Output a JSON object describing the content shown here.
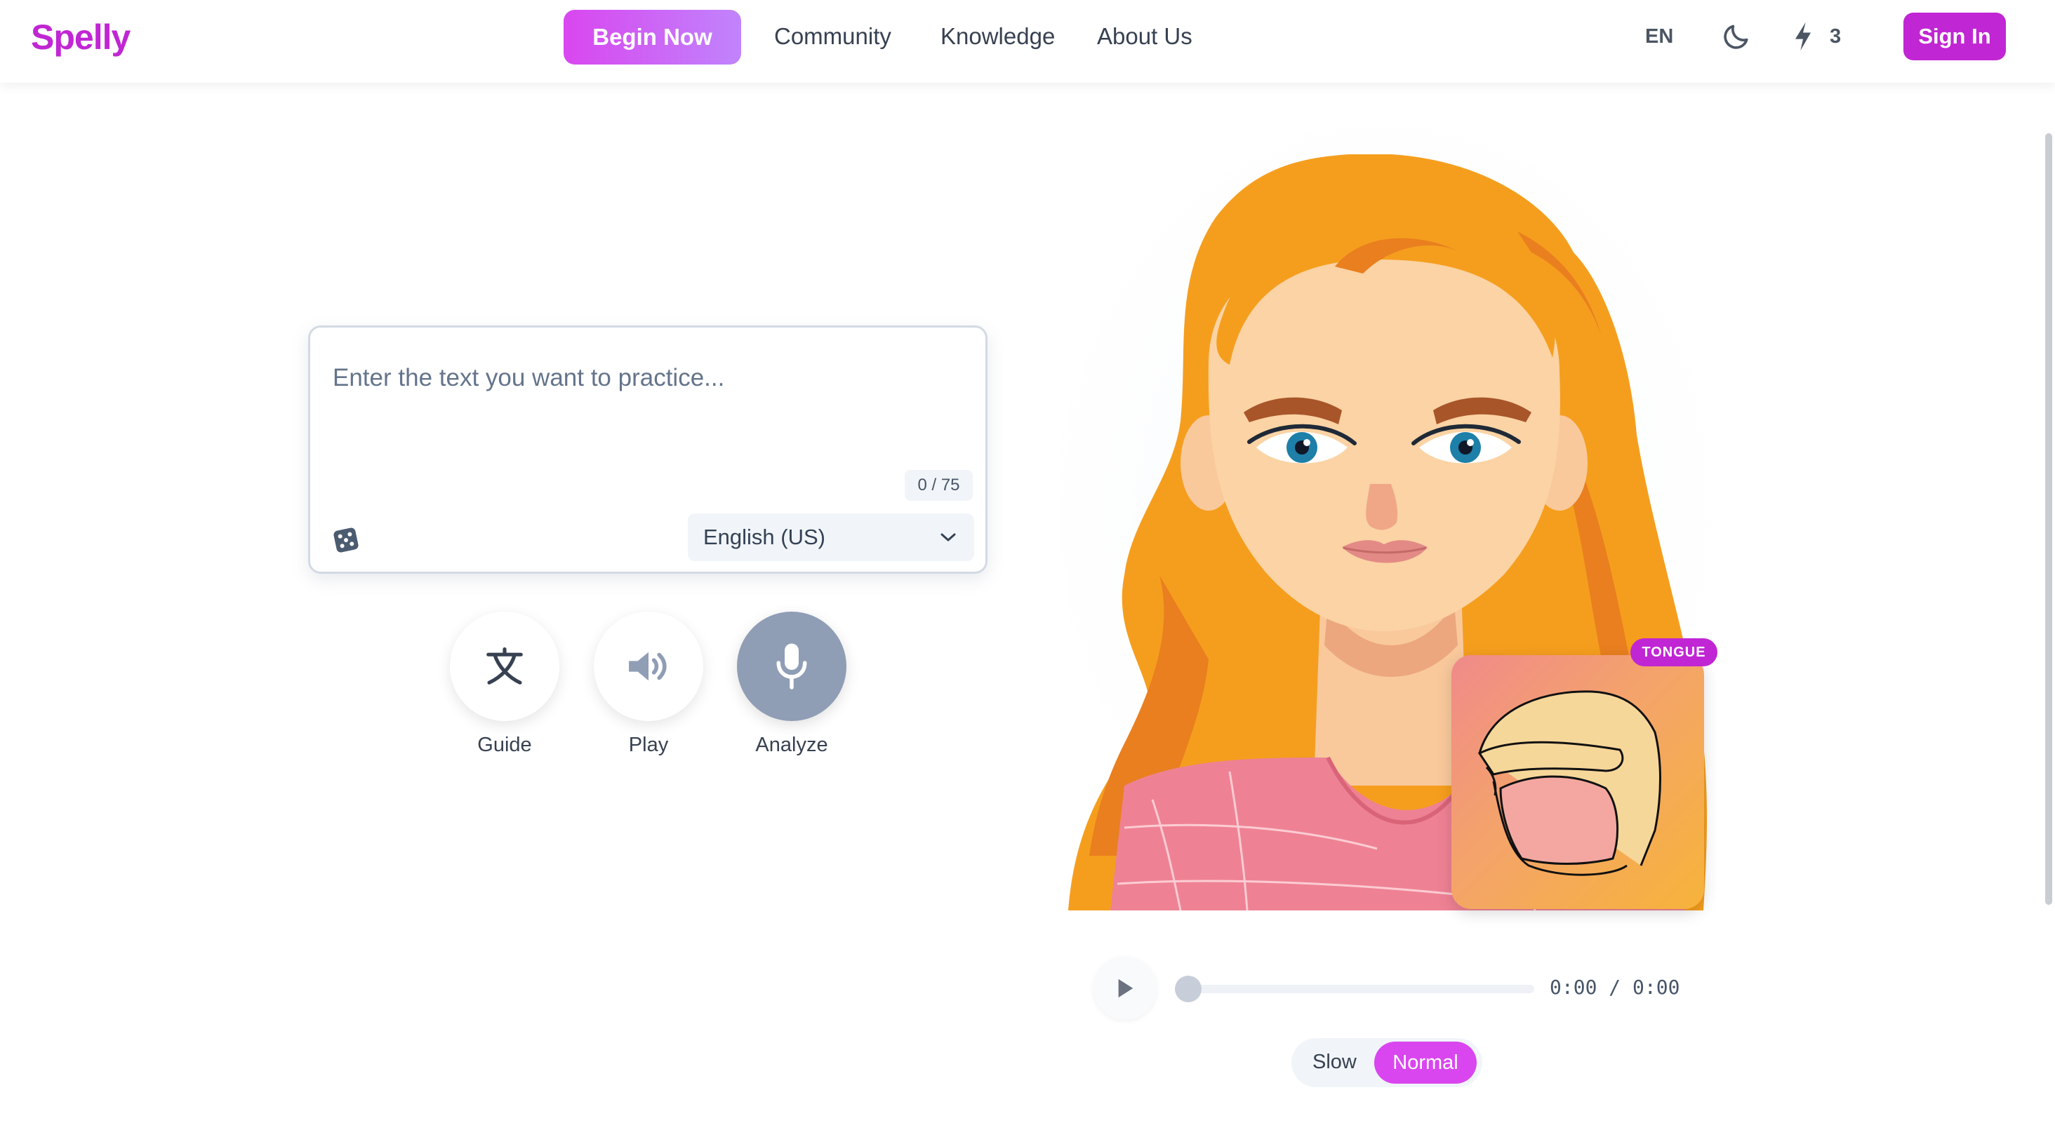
{
  "nav": {
    "logo": "Spelly",
    "begin_label": "Begin Now",
    "links": [
      "Community",
      "Knowledge",
      "About Us"
    ],
    "lang": "EN",
    "energy_count": "3",
    "signin_label": "Sign In"
  },
  "practice": {
    "placeholder": "Enter the text you want to practice...",
    "value": "",
    "counter": "0 / 75",
    "language": "English (US)"
  },
  "actions": {
    "guide": "Guide",
    "play": "Play",
    "analyze": "Analyze"
  },
  "avatar": {
    "badge": "TONGUE"
  },
  "player": {
    "time": "0:00 / 0:00",
    "progress": 0,
    "speed_slow": "Slow",
    "speed_normal": "Normal",
    "selected_speed": "Normal"
  },
  "colors": {
    "brand": "#c026d3",
    "accent": "#d946ef",
    "mic_button": "#8f9db5",
    "hair": "#f59e1e"
  },
  "icons": [
    "dice-icon",
    "translate-icon",
    "speaker-icon",
    "microphone-icon",
    "moon-icon",
    "bolt-icon",
    "chevron-down-icon",
    "play-icon"
  ]
}
